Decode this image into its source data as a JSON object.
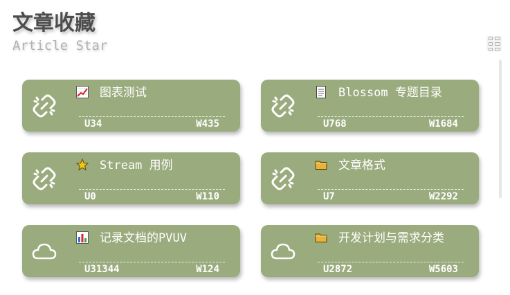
{
  "header": {
    "title": "文章收藏",
    "subtitle": "Article Star"
  },
  "colors": {
    "card_bg": "#9aab7d",
    "title": "#4d4d4d",
    "subtitle": "#b3b3b3"
  },
  "view_toggle": {
    "icon": "grid-list-icon"
  },
  "cards": [
    {
      "icon": "broken-link-icon",
      "emoji": "chart-increasing-icon",
      "title": "图表测试",
      "u": "U34",
      "w": "W435"
    },
    {
      "icon": "broken-link-icon",
      "emoji": "page-icon",
      "title": "Blossom 专题目录",
      "u": "U768",
      "w": "W1684"
    },
    {
      "icon": "broken-link-icon",
      "emoji": "star-icon",
      "title": "Stream 用例",
      "u": "U0",
      "w": "W110"
    },
    {
      "icon": "broken-link-icon",
      "emoji": "folder-icon",
      "title": "文章格式",
      "u": "U7",
      "w": "W2292"
    },
    {
      "icon": "cloud-icon",
      "emoji": "bar-chart-icon",
      "title": "记录文档的PVUV",
      "u": "U31344",
      "w": "W124"
    },
    {
      "icon": "cloud-icon",
      "emoji": "folder-icon",
      "title": "开发计划与需求分类",
      "u": "U2872",
      "w": "W5603"
    }
  ]
}
